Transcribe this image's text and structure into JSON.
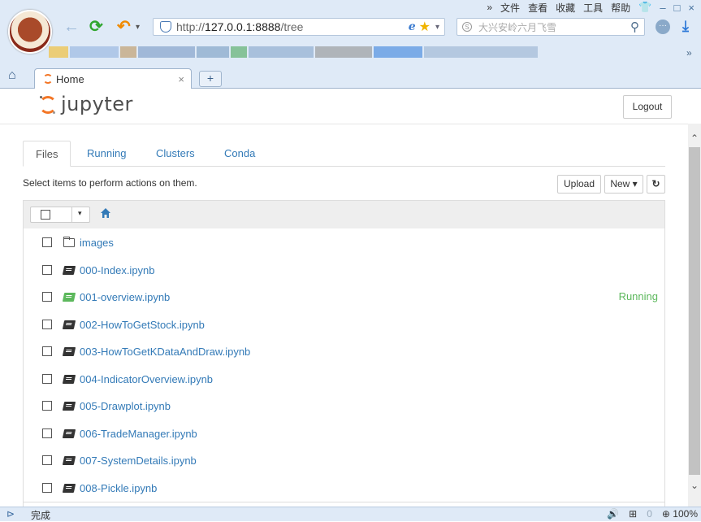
{
  "browser": {
    "menu_items": [
      "»",
      "文件",
      "查看",
      "收藏",
      "工具",
      "帮助"
    ],
    "window_controls": {
      "skin": "👕",
      "minimize": "–",
      "maximize": "□",
      "close": "×"
    },
    "back_glyph": "←",
    "refresh_glyph": "⟳",
    "undo_glyph": "↶",
    "undo_caret": "▾",
    "address": {
      "prefix": "http://",
      "host": "127.0.0.1:8888",
      "path": "/tree"
    },
    "address_ie": "e",
    "address_star": "★",
    "address_caret": "▾",
    "search_badge": "S",
    "search_placeholder": "大兴安岭六月飞雪",
    "search_glyph": "⚲",
    "more_glyph": "···",
    "download_glyph": "⤓",
    "bookmarks_more": "»",
    "home_glyph": "⌂",
    "tab_title": "Home",
    "tab_close": "×",
    "new_tab_glyph": "+",
    "accent_colors": [
      "#f0c040",
      "#b0c8e8",
      "#a0a0a0",
      "#c0a070",
      "#40a0e0",
      "#90c0a0",
      "#50b070",
      "#7090c0",
      "#606060",
      "#3080e0"
    ]
  },
  "jupyter": {
    "logo_text": "jupyter",
    "logout_label": "Logout",
    "tabs": [
      "Files",
      "Running",
      "Clusters",
      "Conda"
    ],
    "hint": "Select items to perform actions on them.",
    "upload_label": "Upload",
    "new_label": "New ▾",
    "refresh_glyph": "↻",
    "select_caret": "▾",
    "scroll_up": "⌃",
    "scroll_down": "⌄",
    "rows": [
      {
        "name": "images",
        "type": "folder",
        "status": ""
      },
      {
        "name": "000-Index.ipynb",
        "type": "notebook",
        "status": ""
      },
      {
        "name": "001-overview.ipynb",
        "type": "notebook-running",
        "status": "Running"
      },
      {
        "name": "002-HowToGetStock.ipynb",
        "type": "notebook",
        "status": ""
      },
      {
        "name": "003-HowToGetKDataAndDraw.ipynb",
        "type": "notebook",
        "status": ""
      },
      {
        "name": "004-IndicatorOverview.ipynb",
        "type": "notebook",
        "status": ""
      },
      {
        "name": "005-Drawplot.ipynb",
        "type": "notebook",
        "status": ""
      },
      {
        "name": "006-TradeManager.ipynb",
        "type": "notebook",
        "status": ""
      },
      {
        "name": "007-SystemDetails.ipynb",
        "type": "notebook",
        "status": ""
      },
      {
        "name": "008-Pickle.ipynb",
        "type": "notebook",
        "status": ""
      }
    ],
    "colors": {
      "link": "#337ab7",
      "running": "#5cb85c",
      "logo_orange": "#f37626"
    }
  },
  "statusbar": {
    "left_glyph": "⊳",
    "done": "完成",
    "right": [
      "🔊",
      "⊞",
      "0",
      "⊕ 100%"
    ]
  }
}
